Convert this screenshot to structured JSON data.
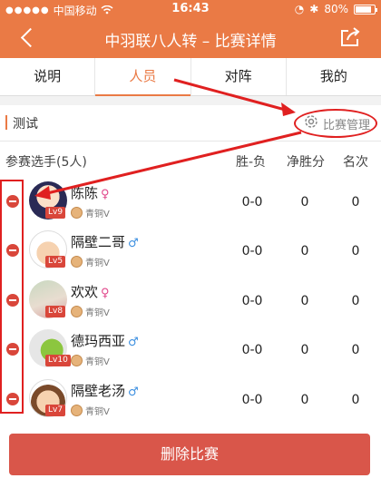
{
  "status_bar": {
    "carrier": "中国移动",
    "time": "16:43",
    "battery": "80%"
  },
  "nav": {
    "title": "中羽联八人转 – 比赛详情"
  },
  "tabs": [
    "说明",
    "人员",
    "对阵",
    "我的"
  ],
  "section": {
    "title": "测试",
    "manage_label": "比赛管理"
  },
  "table": {
    "header_players": "参赛选手(5人)",
    "header_wl": "胜-负",
    "header_net": "净胜分",
    "header_rank": "名次",
    "rows": [
      {
        "name": "陈陈",
        "gender": "♀",
        "level": "Lv9",
        "rank_title": "青铜V",
        "wl": "0-0",
        "net": "0",
        "place": "0"
      },
      {
        "name": "隔壁二哥",
        "gender": "♂",
        "level": "Lv5",
        "rank_title": "青铜V",
        "wl": "0-0",
        "net": "0",
        "place": "0"
      },
      {
        "name": "欢欢",
        "gender": "♀",
        "level": "Lv8",
        "rank_title": "青铜V",
        "wl": "0-0",
        "net": "0",
        "place": "0"
      },
      {
        "name": "德玛西亚",
        "gender": "♂",
        "level": "Lv10",
        "rank_title": "青铜V",
        "wl": "0-0",
        "net": "0",
        "place": "0"
      },
      {
        "name": "隔壁老汤",
        "gender": "♂",
        "level": "Lv7",
        "rank_title": "青铜V",
        "wl": "0-0",
        "net": "0",
        "place": "0"
      }
    ]
  },
  "delete_button": "删除比赛",
  "colors": {
    "accent": "#ea7a45",
    "danger": "#d9564a",
    "annotation": "#e02020",
    "female": "#e0468a",
    "male": "#3c8fe0"
  }
}
